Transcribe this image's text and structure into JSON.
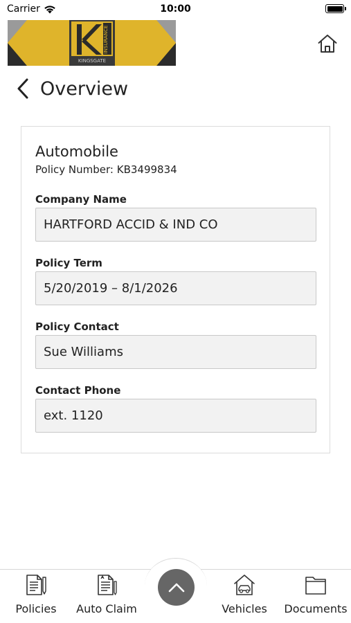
{
  "status_bar": {
    "carrier": "Carrier",
    "time": "10:00"
  },
  "header": {
    "logo": {
      "brand_text": "KINGSGATE",
      "side_text": "INSURANCE",
      "colors": {
        "gold": "#dfb42b",
        "dark": "#2b2b2b",
        "grey": "#9a9a9a"
      }
    },
    "home_icon": "home-icon"
  },
  "page": {
    "back_icon": "chevron-left-icon",
    "title": "Overview"
  },
  "policy": {
    "type": "Automobile",
    "number_line": "Policy Number: KB3499834",
    "fields": [
      {
        "label": "Company Name",
        "value": "HARTFORD ACCID & IND CO"
      },
      {
        "label": "Policy Term",
        "value": "5/20/2019 – 8/1/2026"
      },
      {
        "label": "Policy Contact",
        "value": "Sue Williams"
      },
      {
        "label": "Contact Phone",
        "value": "ext. 1120"
      }
    ]
  },
  "tab_bar": {
    "items": [
      {
        "label": "Policies",
        "icon": "policies-icon"
      },
      {
        "label": "Auto Claim",
        "icon": "auto-claim-icon"
      },
      {
        "label": "Vehicles",
        "icon": "vehicles-icon"
      },
      {
        "label": "Documents",
        "icon": "documents-icon"
      }
    ],
    "center_icon": "chevron-up-icon",
    "colors": {
      "center_button": "#666666"
    }
  }
}
